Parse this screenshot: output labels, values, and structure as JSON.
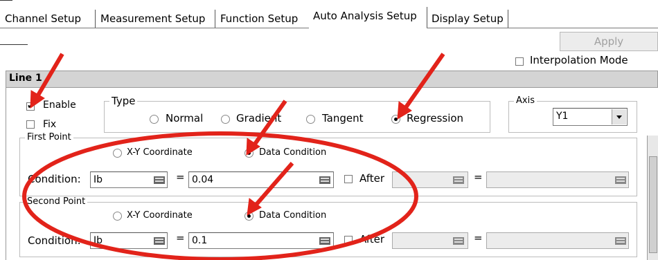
{
  "tabs": [
    {
      "label": "Channel Setup",
      "active": false
    },
    {
      "label": "Measurement Setup",
      "active": false
    },
    {
      "label": "Function Setup",
      "active": false
    },
    {
      "label": "Auto Analysis Setup",
      "active": true
    },
    {
      "label": "Display Setup",
      "active": false
    }
  ],
  "apply_label": "Apply",
  "interpolation": {
    "label": "Interpolation Mode",
    "checked": false
  },
  "line_header": "Line 1",
  "enable": {
    "label": "Enable",
    "checked": true
  },
  "fix": {
    "label": "Fix",
    "checked": false
  },
  "type": {
    "legend": "Type",
    "options": [
      "Normal",
      "Gradient",
      "Tangent",
      "Regression"
    ],
    "selected": "Regression"
  },
  "axis": {
    "legend": "Axis",
    "value": "Y1"
  },
  "first_point": {
    "legend": "First Point",
    "options": [
      "X-Y Coordinate",
      "Data Condition"
    ],
    "selected": "Data Condition",
    "condition_label": "Condition:",
    "variable": "Ib",
    "equals": "=",
    "value": "0.04",
    "after_label": "After",
    "after_checked": false,
    "after_equals": "="
  },
  "second_point": {
    "legend": "Second Point",
    "options": [
      "X-Y Coordinate",
      "Data Condition"
    ],
    "selected": "Data Condition",
    "condition_label": "Condition:",
    "variable": "Ib",
    "equals": "=",
    "value": "0.1",
    "after_label": "After",
    "after_checked": false,
    "after_equals": "="
  },
  "colors": {
    "annotation": "#e2231a",
    "header_bg": "#d4d4d4"
  },
  "annotations": {
    "arrows": 5,
    "ellipse": 1
  }
}
